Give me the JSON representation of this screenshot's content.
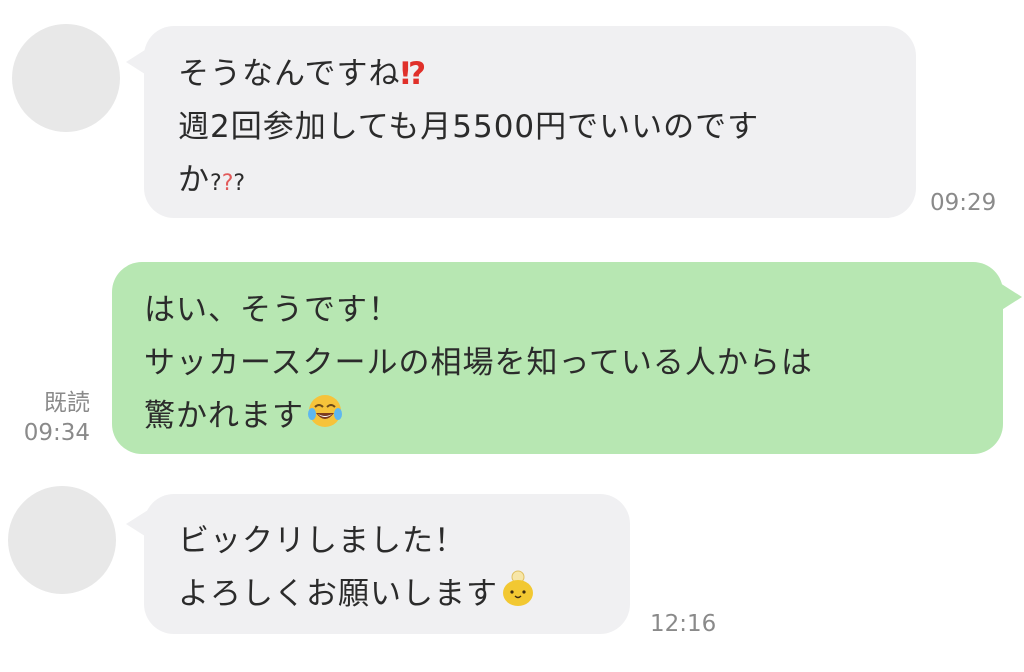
{
  "messages": [
    {
      "direction": "incoming",
      "lines": [
        "そうなんですね",
        "週2回参加しても月5500円でいいのです",
        "か"
      ],
      "line1_emoji": "⁉",
      "line3_suffix": [
        "?",
        "?",
        "?"
      ],
      "time": "09:29"
    },
    {
      "direction": "outgoing",
      "lines": [
        "はい、そうです！",
        "サッカースクールの相場を知っている人からは",
        "驚かれます"
      ],
      "emoji": "face-with-tears-of-joy-icon",
      "read_label": "既読",
      "time": "09:34"
    },
    {
      "direction": "incoming",
      "lines": [
        "ビックリしました！",
        "よろしくお願いします"
      ],
      "emoji": "chick-sticker-icon",
      "time": "12:16"
    }
  ],
  "colors": {
    "incoming_bubble": "#f0f0f2",
    "outgoing_bubble": "#b7e7b2",
    "avatar": "#e8e8e8",
    "meta_text": "#8a8a8a"
  }
}
